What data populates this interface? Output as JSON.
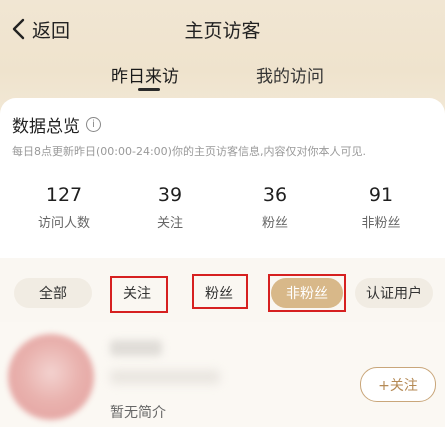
{
  "nav": {
    "back_label": "返回",
    "title": "主页访客"
  },
  "tabs": [
    {
      "label": "昨日来访",
      "active": true
    },
    {
      "label": "我的访问",
      "active": false
    }
  ],
  "overview": {
    "title": "数据总览",
    "subtitle": "每日8点更新昨日(00:00-24:00)你的主页访客信息,内容仅对你本人可见.",
    "stats": [
      {
        "value": "127",
        "label": "访问人数"
      },
      {
        "value": "39",
        "label": "关注"
      },
      {
        "value": "36",
        "label": "粉丝"
      },
      {
        "value": "91",
        "label": "非粉丝"
      }
    ]
  },
  "filters": [
    {
      "label": "全部",
      "active": false
    },
    {
      "label": "关注",
      "active": false
    },
    {
      "label": "粉丝",
      "active": false
    },
    {
      "label": "非粉丝",
      "active": true
    },
    {
      "label": "认证用户",
      "active": false
    }
  ],
  "visitor": {
    "bio": "暂无简介",
    "follow_label": "+关注"
  },
  "colors": {
    "accent": "#d8b889",
    "highlight": "#d62020",
    "follow_text": "#b58a55"
  }
}
